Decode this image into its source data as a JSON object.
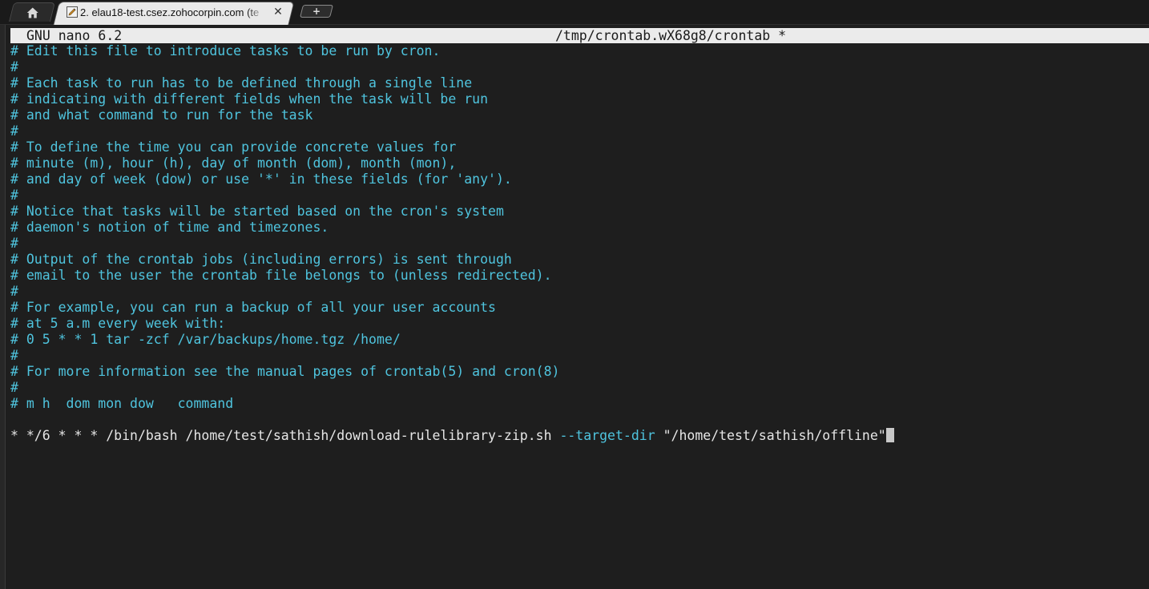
{
  "tabs": {
    "home_icon": "home-icon",
    "active": {
      "icon": "terminal-pencil-icon",
      "title": "2. elau18-test.csez.zohocorpin.com (te",
      "close_label": "✕"
    },
    "new_tab_label": "+"
  },
  "nano": {
    "version": "GNU nano 6.2",
    "filename": "/tmp/crontab.wX68g8/crontab *"
  },
  "editor": {
    "comment_lines": [
      "# Edit this file to introduce tasks to be run by cron.",
      "#",
      "# Each task to run has to be defined through a single line",
      "# indicating with different fields when the task will be run",
      "# and what command to run for the task",
      "#",
      "# To define the time you can provide concrete values for",
      "# minute (m), hour (h), day of month (dom), month (mon),",
      "# and day of week (dow) or use '*' in these fields (for 'any').",
      "#",
      "# Notice that tasks will be started based on the cron's system",
      "# daemon's notion of time and timezones.",
      "#",
      "# Output of the crontab jobs (including errors) is sent through",
      "# email to the user the crontab file belongs to (unless redirected).",
      "#",
      "# For example, you can run a backup of all your user accounts",
      "# at 5 a.m every week with:",
      "# 0 5 * * 1 tar -zcf /var/backups/home.tgz /home/",
      "#",
      "# For more information see the manual pages of crontab(5) and cron(8)",
      "#",
      "# m h  dom mon dow   command"
    ],
    "blank_line": "",
    "cron_entry": {
      "schedule_and_command": "* */6 * * * /bin/bash /home/test/sathish/download-rulelibrary-zip.sh ",
      "option": "--target-dir",
      "argument": " \"/home/test/sathish/offline\""
    }
  },
  "colors": {
    "background": "#1e1e1e",
    "comment": "#4fc4de",
    "text": "#e6e6e6",
    "header_bg": "#ebebeb",
    "active_tab_bg": "#e9e9e9"
  }
}
